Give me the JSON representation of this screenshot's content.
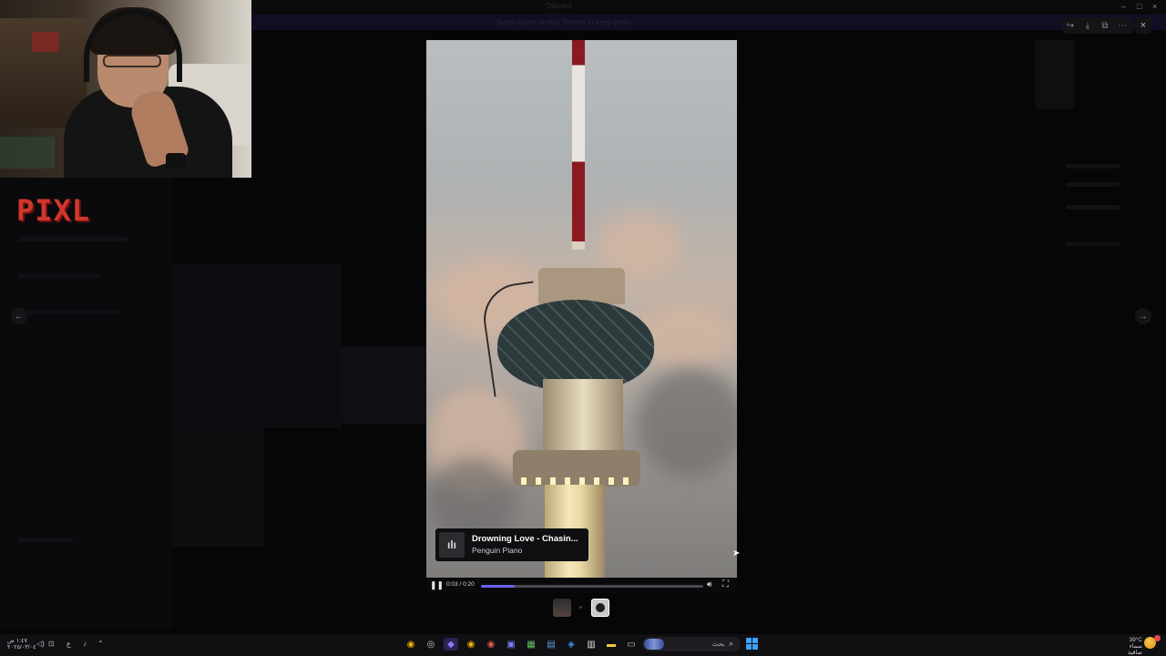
{
  "window": {
    "title": "Discord"
  },
  "banner": {
    "text": "Subscription ended. Renew to keep perks"
  },
  "logo": {
    "text": "PIXL"
  },
  "viewer": {
    "music": {
      "title": "Drowning Love - Chasin...",
      "artist": "Penguin Piano"
    },
    "time": "0:03 / 0:20",
    "progress": 0.15,
    "icons": {
      "play_pause": "pause-icon",
      "volume": "volume-icon",
      "fullscreen": "fullscreen-icon"
    }
  },
  "overlay": {
    "icons": [
      "forward-icon",
      "download-icon",
      "open-external-icon",
      "more-icon"
    ],
    "close": "×",
    "prev": "←",
    "next": "→"
  },
  "taskbar": {
    "clock_line1": "١:٤٧ ص",
    "clock_line2": "٢٠٢٥/٠٣/٠٤",
    "lang": "ع",
    "search_placeholder": "بحث",
    "weather_temp": "39°C",
    "weather_desc": "سماء صافية",
    "apps": [
      "chrome-icon",
      "steam-icon",
      "discord-icon",
      "chrome-icon",
      "chrome-icon",
      "game-controller-icon",
      "terminal-icon",
      "vpn-icon",
      "store-icon",
      "folder-icon",
      "window-icon"
    ]
  },
  "colors": {
    "accent": "#6d63f0",
    "logo": "#d2362c",
    "start": "#3aa0ff"
  }
}
